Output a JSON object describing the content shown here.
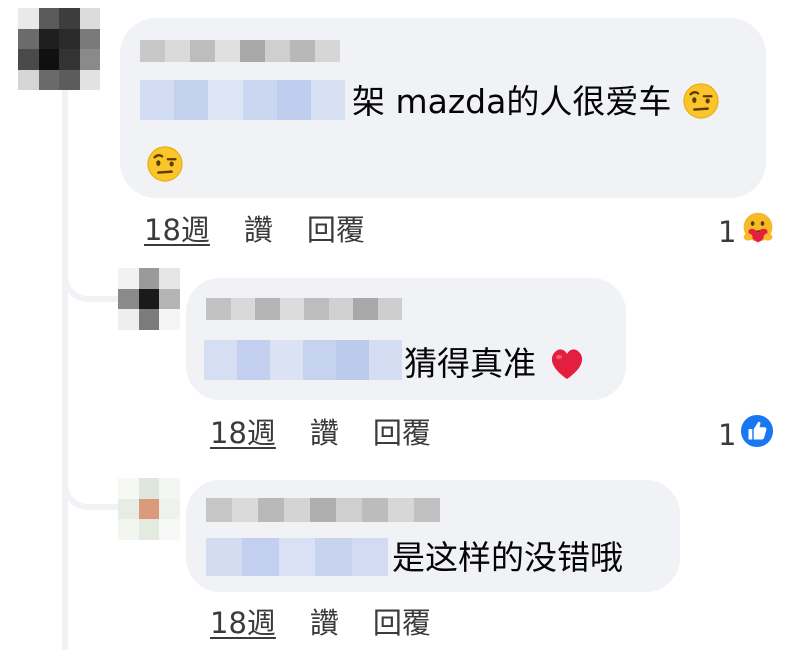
{
  "comments": [
    {
      "text": "架 mazda的人很爱车",
      "time": "18週",
      "like_label": "讚",
      "reply_label": "回覆",
      "reaction_count": "1",
      "reaction_icon": "care-reaction-icon"
    },
    {
      "text": "猜得真准",
      "time": "18週",
      "like_label": "讚",
      "reply_label": "回覆",
      "reaction_count": "1",
      "reaction_icon": "like-reaction-icon"
    },
    {
      "text": "是这样的没错哦",
      "time": "18週",
      "like_label": "讚",
      "reply_label": "回覆"
    }
  ],
  "colors": {
    "bubble": "#f0f2f5",
    "action_text": "#3a3b3c",
    "like_blue": "#1877f2",
    "heart_red": "#e41e3f"
  }
}
